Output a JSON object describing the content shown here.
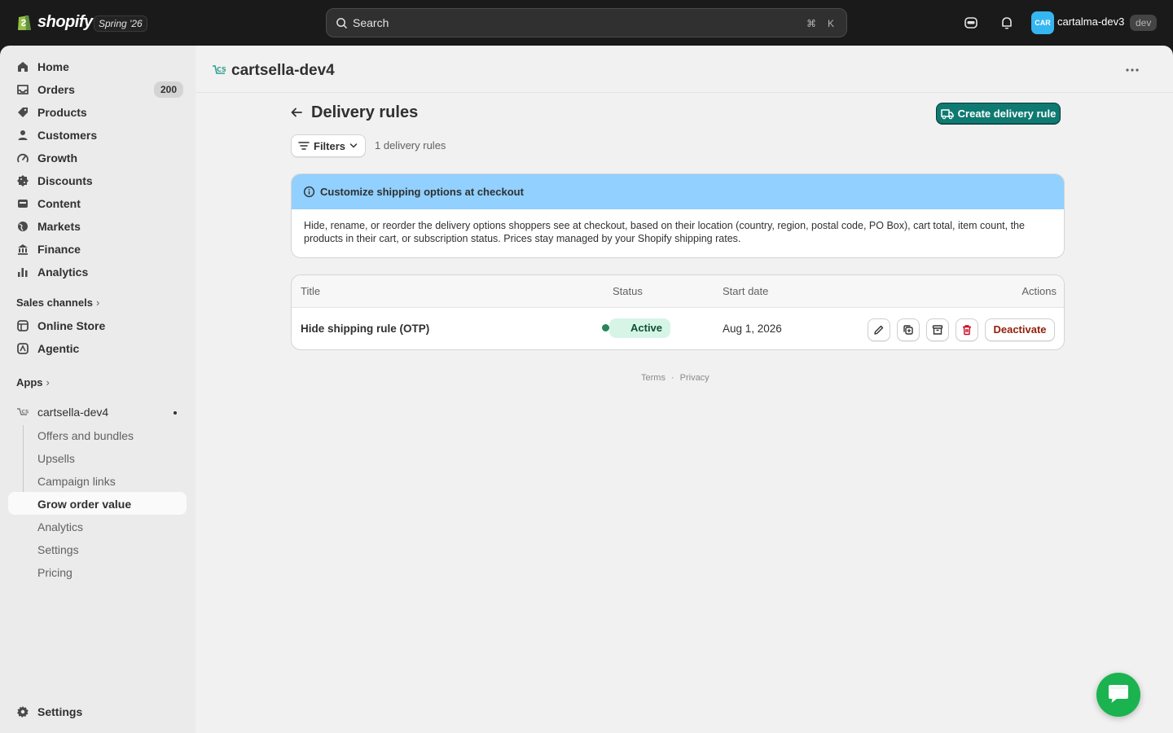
{
  "topbar": {
    "brand": "shopify",
    "edition": "Spring '26",
    "search_placeholder": "Search",
    "shortcut_cmd": "⌘",
    "shortcut_key": "K",
    "avatar_initials": "CAR",
    "store_name": "cartalma-dev3",
    "env_badge": "dev"
  },
  "sidebar": {
    "items": [
      {
        "label": "Home",
        "icon": "home-icon"
      },
      {
        "label": "Orders",
        "icon": "orders-icon",
        "badge": "200"
      },
      {
        "label": "Products",
        "icon": "tag-icon"
      },
      {
        "label": "Customers",
        "icon": "person-icon"
      },
      {
        "label": "Growth",
        "icon": "growth-icon"
      },
      {
        "label": "Discounts",
        "icon": "discount-icon"
      },
      {
        "label": "Content",
        "icon": "content-icon"
      },
      {
        "label": "Markets",
        "icon": "globe-icon"
      },
      {
        "label": "Finance",
        "icon": "bank-icon"
      },
      {
        "label": "Analytics",
        "icon": "bar-chart-icon"
      }
    ],
    "sales_channels_title": "Sales channels",
    "channels": [
      {
        "label": "Online Store",
        "icon": "store-icon"
      },
      {
        "label": "Agentic",
        "icon": "agentic-icon"
      }
    ],
    "apps_title": "Apps",
    "app": {
      "label": "cartsella-dev4",
      "sub_items": [
        {
          "label": "Offers and bundles"
        },
        {
          "label": "Upsells"
        },
        {
          "label": "Campaign links"
        },
        {
          "label": "Grow order value",
          "active": true
        },
        {
          "label": "Analytics"
        },
        {
          "label": "Settings"
        },
        {
          "label": "Pricing"
        }
      ]
    },
    "settings_label": "Settings"
  },
  "app_header": {
    "title": "cartsella-dev4"
  },
  "page": {
    "title": "Delivery rules",
    "primary_action": "Create delivery rule",
    "filters_label": "Filters",
    "rule_count": "1 delivery rules"
  },
  "banner": {
    "title": "Customize shipping options at checkout",
    "body": "Hide, rename, or reorder the delivery options shoppers see at checkout, based on their location (country, region, postal code, PO Box), cart total, item count, the products in their cart, or subscription status. Prices stay managed by your Shopify shipping rates."
  },
  "table": {
    "headers": {
      "title": "Title",
      "status": "Status",
      "start_date": "Start date",
      "actions": "Actions"
    },
    "rows": [
      {
        "title": "Hide shipping rule (OTP)",
        "status": "Active",
        "start_date": "Aug 1, 2026",
        "deactivate_label": "Deactivate"
      }
    ]
  },
  "footer": {
    "terms": "Terms",
    "separator": "·",
    "privacy": "Privacy"
  },
  "colors": {
    "topbar_bg": "#1a1a1a",
    "primary_button": "#0e7a72",
    "banner_header": "#91d0ff",
    "status_active_bg": "#d7f5e7",
    "destructive": "#8e1f0b",
    "chat_button": "#1bb34f"
  }
}
